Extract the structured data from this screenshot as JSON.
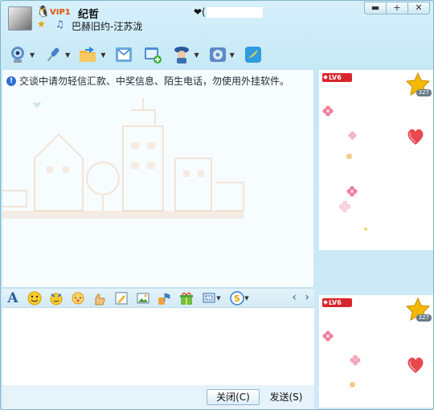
{
  "header": {
    "vip_badge": "VIP1",
    "nickname": "纪哲",
    "song": "巴赫旧约-汪苏泷",
    "status_prefix": "❤("
  },
  "window_controls": {
    "minimize": "▬",
    "maximize": "+",
    "close": "✕"
  },
  "toolbar": {
    "icons": [
      "webcam-icon",
      "microphone-icon",
      "folder-transfer-icon",
      "email-icon",
      "add-app-icon",
      "remote-assist-icon",
      "settings-icon",
      "qzone-icon"
    ]
  },
  "chat": {
    "notice": "交谈中请勿轻信汇款、中奖信息、陌生电话，勿使用外挂软件。"
  },
  "emoticon_bar": {
    "font_label": "A",
    "nav_prev": "‹",
    "nav_next": "›"
  },
  "buttons": {
    "close": "关闭(C)",
    "send": "发送(S)"
  },
  "profile_panel": {
    "level": "LV6",
    "star_count": "327"
  },
  "colors": {
    "accent": "#3a8fd9",
    "vip": "#e74d00",
    "level_badge": "#d8252b",
    "star": "#f5b800",
    "heart": "#e8484f"
  }
}
